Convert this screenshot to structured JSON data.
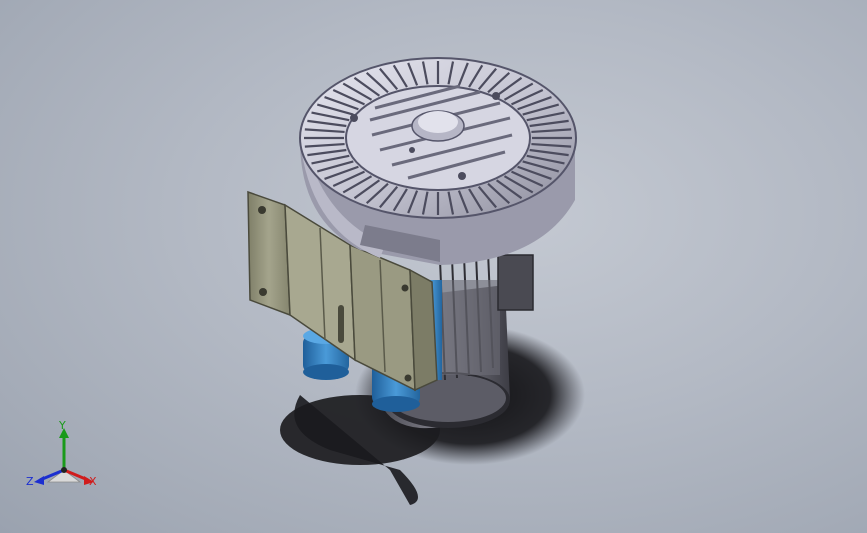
{
  "scene": {
    "background": "#b3b9c4",
    "model": {
      "description_icon": "blower-motor-assembly-icon",
      "colors": {
        "housing": "#c9c9d6",
        "housing_shadow": "#8e8e9e",
        "bracket": "#9c9c84",
        "motor_blue": "#3a86c8",
        "fins_dark": "#5a5a62",
        "shadow": "#1e1e22"
      }
    }
  },
  "triad": {
    "x_label": "X",
    "y_label": "Y",
    "z_label": "Z",
    "x_color": "#d01c1c",
    "y_color": "#1a9a1a",
    "z_color": "#1c2fd0"
  }
}
